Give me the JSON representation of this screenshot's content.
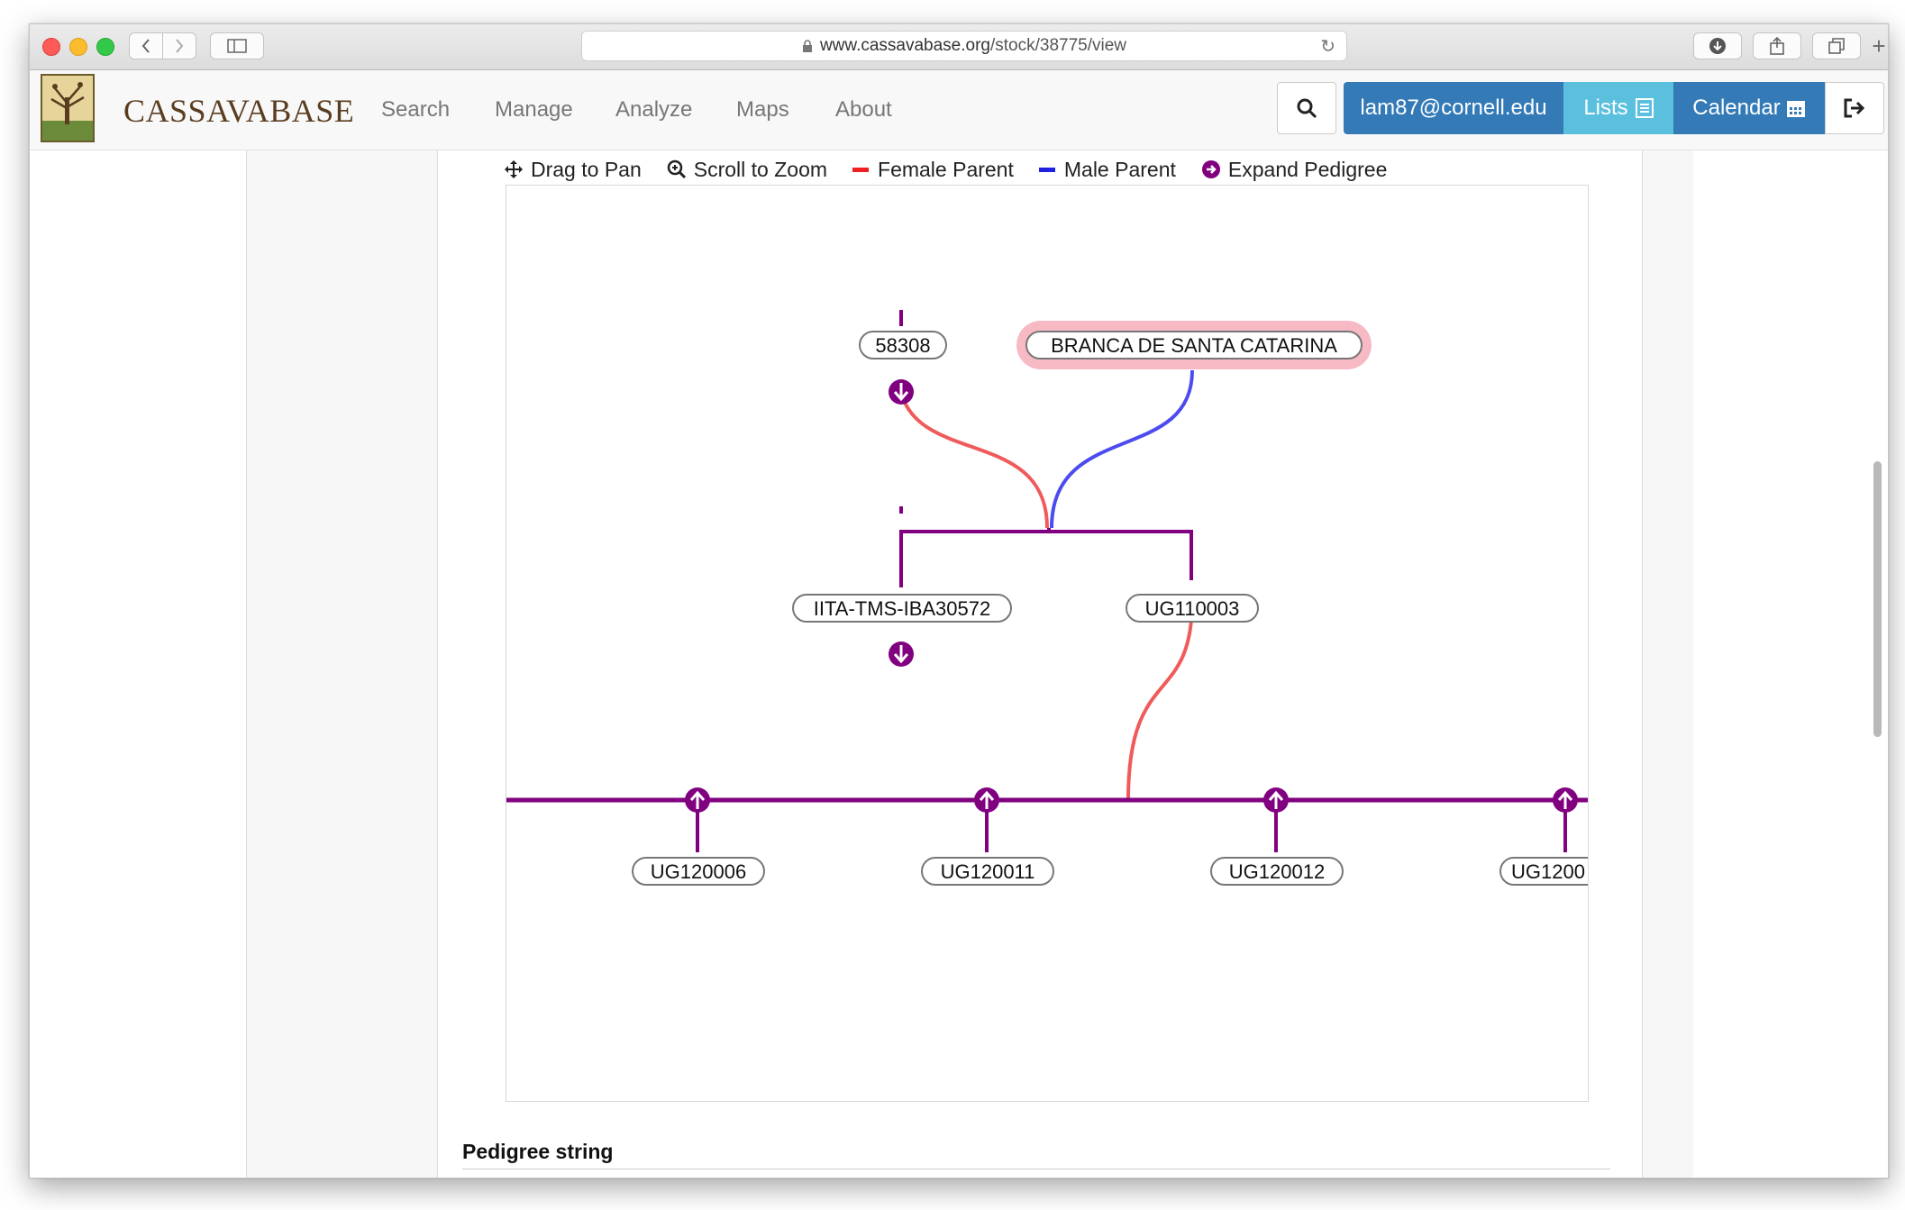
{
  "browser": {
    "url_host": "www.cassavabase.org",
    "url_path": "/stock/38775/view"
  },
  "site": {
    "brand": "CASSAVABASE",
    "nav": [
      "Search",
      "Manage",
      "Analyze",
      "Maps",
      "About"
    ],
    "user": "lam87@cornell.edu",
    "lists_label": "Lists",
    "calendar_label": "Calendar"
  },
  "legend": {
    "pan": "Drag to Pan",
    "zoom": "Scroll to Zoom",
    "female": "Female Parent",
    "male": "Male Parent",
    "expand": "Expand Pedigree"
  },
  "colors": {
    "female": "#f05a5a",
    "male": "#4b4bf0",
    "link": "#800080",
    "highlight": "#f7b9c4"
  },
  "pedigree": {
    "grandparents": [
      "58308",
      "BRANCA DE SANTA CATARINA"
    ],
    "parents": [
      "IITA-TMS-IBA30572",
      "UG110003"
    ],
    "progeny": [
      "UG120006",
      "UG120011",
      "UG120012",
      "UG1200"
    ]
  },
  "section": {
    "pedigree_string_title": "Pedigree string"
  }
}
